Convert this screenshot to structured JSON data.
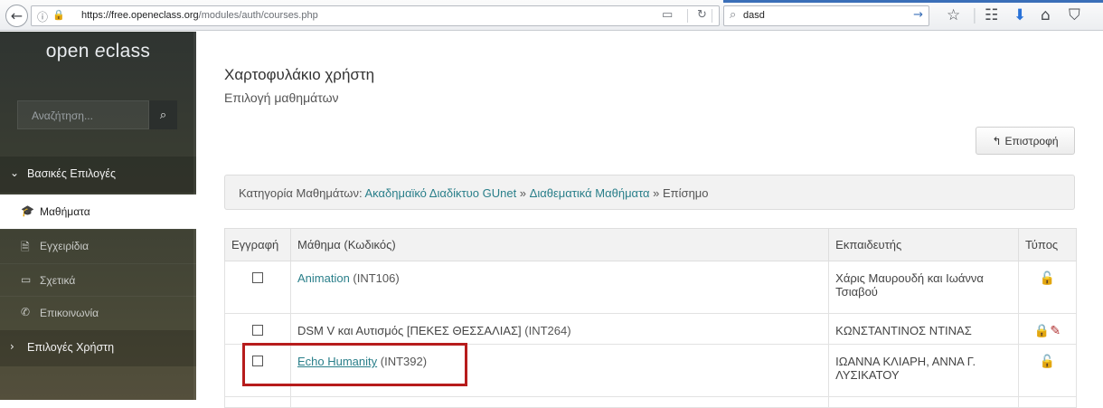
{
  "browser": {
    "url_host": "https://free.openeclass.org",
    "url_path": "/modules/auth/courses.php",
    "search_value": "dasd",
    "icons": [
      "back-arrow-icon",
      "info-icon",
      "lock-icon",
      "reader-icon",
      "reload-icon",
      "search-icon",
      "go-arrow-icon",
      "star-icon",
      "reading-list-icon",
      "download-icon",
      "home-icon",
      "pocket-icon"
    ]
  },
  "sidebar": {
    "brand_prefix": "open ",
    "brand_e": "e",
    "brand_suffix": "class",
    "search_placeholder": "Αναζήτηση...",
    "section_main": "Βασικές Επιλογές",
    "items": [
      {
        "label": "Μαθήματα",
        "icon": "graduation-cap-icon",
        "active": true
      },
      {
        "label": "Εγχειρίδια",
        "icon": "document-icon",
        "active": false
      },
      {
        "label": "Σχετικά",
        "icon": "card-icon",
        "active": false
      },
      {
        "label": "Επικοινωνία",
        "icon": "phone-icon",
        "active": false
      }
    ],
    "section_user": "Επιλογές Χρήστη"
  },
  "main": {
    "title": "Χαρτοφυλάκιο χρήστη",
    "subtitle": "Επιλογή μαθημάτων",
    "back_button": "Επιστροφή",
    "breadcrumb": {
      "prefix": "Κατηγορία Μαθημάτων: ",
      "link1": "Ακαδημαϊκό Διαδίκτυο GUnet",
      "sep1": " » ",
      "link2": "Διαθεματικά Μαθήματα",
      "sep2": " » ",
      "current": "Επίσημο"
    },
    "table": {
      "headers": [
        "Εγγραφή",
        "Μάθημα (Κωδικός)",
        "Εκπαιδευτής",
        "Τύπος"
      ],
      "rows": [
        {
          "course": "Animation",
          "code": " (INT106)",
          "linked": true,
          "teacher": "Χάρις Μαυρουδή και Ιωάννα Τσιαβού",
          "type": "open"
        },
        {
          "course": "DSM V και Αυτισμός [ΠΕΚΕΣ ΘΕΣΣΑΛΙΑΣ]",
          "code": " (INT264)",
          "linked": false,
          "teacher": "ΚΩΝΣΤΑΝΤΙΝΟΣ ΝΤΙΝΑΣ",
          "type": "registration"
        },
        {
          "course": "Echo Humanity",
          "code": " (INT392)",
          "linked": true,
          "teacher": "ΙΩΑΝΝΑ ΚΛΙΑΡΗ, ΑΝΝΑ Γ. ΛΥΣΙΚΑΤΟΥ",
          "type": "open"
        }
      ]
    },
    "highlight_color": "#b71c1c"
  }
}
